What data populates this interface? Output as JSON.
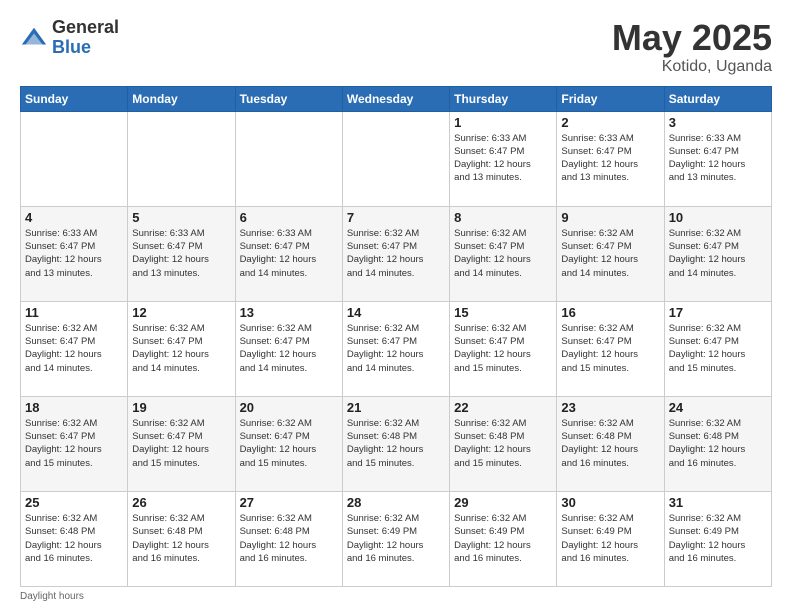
{
  "logo": {
    "general": "General",
    "blue": "Blue"
  },
  "title": {
    "month": "May 2025",
    "location": "Kotido, Uganda"
  },
  "days_of_week": [
    "Sunday",
    "Monday",
    "Tuesday",
    "Wednesday",
    "Thursday",
    "Friday",
    "Saturday"
  ],
  "footer": {
    "daylight_label": "Daylight hours"
  },
  "weeks": [
    [
      {
        "day": "",
        "info": ""
      },
      {
        "day": "",
        "info": ""
      },
      {
        "day": "",
        "info": ""
      },
      {
        "day": "",
        "info": ""
      },
      {
        "day": "1",
        "info": "Sunrise: 6:33 AM\nSunset: 6:47 PM\nDaylight: 12 hours\nand 13 minutes."
      },
      {
        "day": "2",
        "info": "Sunrise: 6:33 AM\nSunset: 6:47 PM\nDaylight: 12 hours\nand 13 minutes."
      },
      {
        "day": "3",
        "info": "Sunrise: 6:33 AM\nSunset: 6:47 PM\nDaylight: 12 hours\nand 13 minutes."
      }
    ],
    [
      {
        "day": "4",
        "info": "Sunrise: 6:33 AM\nSunset: 6:47 PM\nDaylight: 12 hours\nand 13 minutes."
      },
      {
        "day": "5",
        "info": "Sunrise: 6:33 AM\nSunset: 6:47 PM\nDaylight: 12 hours\nand 13 minutes."
      },
      {
        "day": "6",
        "info": "Sunrise: 6:33 AM\nSunset: 6:47 PM\nDaylight: 12 hours\nand 14 minutes."
      },
      {
        "day": "7",
        "info": "Sunrise: 6:32 AM\nSunset: 6:47 PM\nDaylight: 12 hours\nand 14 minutes."
      },
      {
        "day": "8",
        "info": "Sunrise: 6:32 AM\nSunset: 6:47 PM\nDaylight: 12 hours\nand 14 minutes."
      },
      {
        "day": "9",
        "info": "Sunrise: 6:32 AM\nSunset: 6:47 PM\nDaylight: 12 hours\nand 14 minutes."
      },
      {
        "day": "10",
        "info": "Sunrise: 6:32 AM\nSunset: 6:47 PM\nDaylight: 12 hours\nand 14 minutes."
      }
    ],
    [
      {
        "day": "11",
        "info": "Sunrise: 6:32 AM\nSunset: 6:47 PM\nDaylight: 12 hours\nand 14 minutes."
      },
      {
        "day": "12",
        "info": "Sunrise: 6:32 AM\nSunset: 6:47 PM\nDaylight: 12 hours\nand 14 minutes."
      },
      {
        "day": "13",
        "info": "Sunrise: 6:32 AM\nSunset: 6:47 PM\nDaylight: 12 hours\nand 14 minutes."
      },
      {
        "day": "14",
        "info": "Sunrise: 6:32 AM\nSunset: 6:47 PM\nDaylight: 12 hours\nand 14 minutes."
      },
      {
        "day": "15",
        "info": "Sunrise: 6:32 AM\nSunset: 6:47 PM\nDaylight: 12 hours\nand 15 minutes."
      },
      {
        "day": "16",
        "info": "Sunrise: 6:32 AM\nSunset: 6:47 PM\nDaylight: 12 hours\nand 15 minutes."
      },
      {
        "day": "17",
        "info": "Sunrise: 6:32 AM\nSunset: 6:47 PM\nDaylight: 12 hours\nand 15 minutes."
      }
    ],
    [
      {
        "day": "18",
        "info": "Sunrise: 6:32 AM\nSunset: 6:47 PM\nDaylight: 12 hours\nand 15 minutes."
      },
      {
        "day": "19",
        "info": "Sunrise: 6:32 AM\nSunset: 6:47 PM\nDaylight: 12 hours\nand 15 minutes."
      },
      {
        "day": "20",
        "info": "Sunrise: 6:32 AM\nSunset: 6:47 PM\nDaylight: 12 hours\nand 15 minutes."
      },
      {
        "day": "21",
        "info": "Sunrise: 6:32 AM\nSunset: 6:48 PM\nDaylight: 12 hours\nand 15 minutes."
      },
      {
        "day": "22",
        "info": "Sunrise: 6:32 AM\nSunset: 6:48 PM\nDaylight: 12 hours\nand 15 minutes."
      },
      {
        "day": "23",
        "info": "Sunrise: 6:32 AM\nSunset: 6:48 PM\nDaylight: 12 hours\nand 16 minutes."
      },
      {
        "day": "24",
        "info": "Sunrise: 6:32 AM\nSunset: 6:48 PM\nDaylight: 12 hours\nand 16 minutes."
      }
    ],
    [
      {
        "day": "25",
        "info": "Sunrise: 6:32 AM\nSunset: 6:48 PM\nDaylight: 12 hours\nand 16 minutes."
      },
      {
        "day": "26",
        "info": "Sunrise: 6:32 AM\nSunset: 6:48 PM\nDaylight: 12 hours\nand 16 minutes."
      },
      {
        "day": "27",
        "info": "Sunrise: 6:32 AM\nSunset: 6:48 PM\nDaylight: 12 hours\nand 16 minutes."
      },
      {
        "day": "28",
        "info": "Sunrise: 6:32 AM\nSunset: 6:49 PM\nDaylight: 12 hours\nand 16 minutes."
      },
      {
        "day": "29",
        "info": "Sunrise: 6:32 AM\nSunset: 6:49 PM\nDaylight: 12 hours\nand 16 minutes."
      },
      {
        "day": "30",
        "info": "Sunrise: 6:32 AM\nSunset: 6:49 PM\nDaylight: 12 hours\nand 16 minutes."
      },
      {
        "day": "31",
        "info": "Sunrise: 6:32 AM\nSunset: 6:49 PM\nDaylight: 12 hours\nand 16 minutes."
      }
    ]
  ]
}
